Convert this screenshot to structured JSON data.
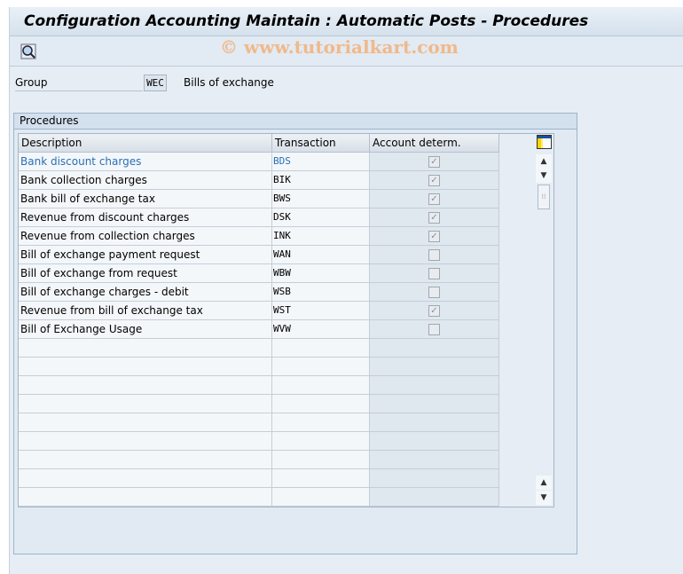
{
  "title": "Configuration Accounting Maintain : Automatic Posts - Procedures",
  "watermark": "© www.tutorialkart.com",
  "toolbar": {
    "icons": [
      "detail-view-icon"
    ]
  },
  "group": {
    "label": "Group",
    "value": "WEC",
    "description": "Bills of exchange"
  },
  "procedures": {
    "title": "Procedures",
    "columns": [
      "Description",
      "Transaction",
      "Account determ."
    ],
    "rows": [
      {
        "description": "Bank discount charges",
        "transaction": "BDS",
        "account_determ": true
      },
      {
        "description": "Bank collection charges",
        "transaction": "BIK",
        "account_determ": true
      },
      {
        "description": "Bank bill of exchange tax",
        "transaction": "BWS",
        "account_determ": true
      },
      {
        "description": "Revenue from discount charges",
        "transaction": "DSK",
        "account_determ": true
      },
      {
        "description": "Revenue from collection charges",
        "transaction": "INK",
        "account_determ": true
      },
      {
        "description": "Bill of exchange payment request",
        "transaction": "WAN",
        "account_determ": false
      },
      {
        "description": "Bill of exchange from request",
        "transaction": "WBW",
        "account_determ": false
      },
      {
        "description": "Bill of exchange charges - debit",
        "transaction": "WSB",
        "account_determ": false
      },
      {
        "description": "Revenue from bill of exchange tax",
        "transaction": "WST",
        "account_determ": true
      },
      {
        "description": "Bill of Exchange Usage",
        "transaction": "WVW",
        "account_determ": false
      }
    ],
    "empty_rows": 9
  }
}
